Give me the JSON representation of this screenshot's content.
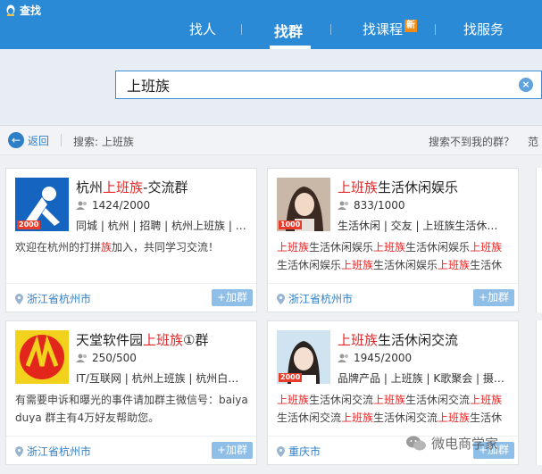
{
  "app": {
    "title": "查找"
  },
  "tabs": [
    {
      "label": "找人",
      "active": false
    },
    {
      "label": "找群",
      "active": true
    },
    {
      "label": "找课程",
      "active": false,
      "badge": "新"
    },
    {
      "label": "找服务",
      "active": false
    }
  ],
  "search": {
    "value": "上班族"
  },
  "crumbs": {
    "back": "返回",
    "query": "搜索: 上班族",
    "help": "搜索不到我的群？",
    "more": "范"
  },
  "groups": [
    {
      "name_pre": "杭州",
      "name_hl": "上班族",
      "name_post": "-交流群",
      "members": "1424/2000",
      "tags": "同城 | 杭州 | 招聘 | 杭州上班族 | …",
      "desc": [
        {
          "t": "欢迎在杭州的打拼",
          "h": false
        },
        {
          "t": "族",
          "h": true
        },
        {
          "t": "加入，共同学习交流！",
          "h": false
        }
      ],
      "level": "2000",
      "location": "浙江省杭州市",
      "join": "+加群"
    },
    {
      "name_pre": "",
      "name_hl": "上班族",
      "name_post": "生活休闲娱乐",
      "members": "833/1000",
      "tags": "生活休闲 | 交友 | 上班族生活休…",
      "desc": [
        {
          "t": "上班族",
          "h": true
        },
        {
          "t": "生活休闲娱乐",
          "h": false
        },
        {
          "t": "上班族",
          "h": true
        },
        {
          "t": "生活休闲娱乐",
          "h": false
        },
        {
          "t": "上班族",
          "h": true
        },
        {
          "t": "生活休闲娱乐",
          "h": false
        },
        {
          "t": "上班族",
          "h": true
        },
        {
          "t": "生活休闲娱乐",
          "h": false
        },
        {
          "t": "上班族",
          "h": true
        },
        {
          "t": "生活休闲娱乐",
          "h": false
        }
      ],
      "level": "1000",
      "location": "浙江省杭州市",
      "join": "+加群"
    },
    {
      "name_pre": "天堂软件园",
      "name_hl": "上班族",
      "name_post": "①群",
      "members": "250/500",
      "tags": "IT/互联网 | 杭州上班族 | 杭州白…",
      "desc": [
        {
          "t": "有需要申诉和曝光的事件请加群主微信号：baiyaduya 群主有4万好友帮助您。",
          "h": false
        }
      ],
      "level": "",
      "location": "浙江省杭州市",
      "join": "+加群"
    },
    {
      "name_pre": "",
      "name_hl": "上班族",
      "name_post": "生活休闲交流",
      "members": "1945/2000",
      "tags": "品牌产品 | 上班族 | K歌聚会 | 摄…",
      "desc": [
        {
          "t": "上班族",
          "h": true
        },
        {
          "t": "生活休闲交流",
          "h": false
        },
        {
          "t": "上班族",
          "h": true
        },
        {
          "t": "生活休闲交流",
          "h": false
        },
        {
          "t": "上班族",
          "h": true
        },
        {
          "t": "生活休闲交流",
          "h": false
        },
        {
          "t": "上班族",
          "h": true
        },
        {
          "t": "生活休闲交流",
          "h": false
        },
        {
          "t": "上班族",
          "h": true
        },
        {
          "t": "生活休闲交流",
          "h": false
        }
      ],
      "level": "2000",
      "location": "重庆市",
      "join": "+加群"
    }
  ],
  "watermark": "微电商学家",
  "colors": {
    "topbar": "#2b8ad6",
    "highlight": "#e32727",
    "link": "#2f7fc7"
  }
}
